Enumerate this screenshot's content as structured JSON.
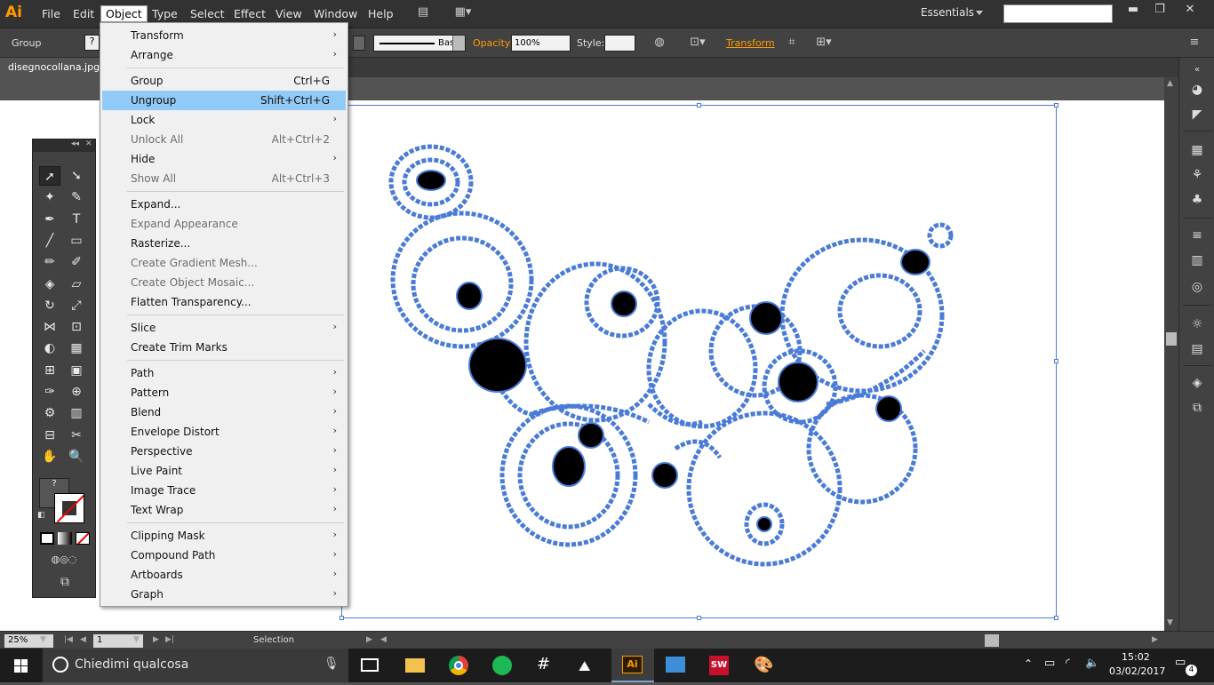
{
  "app": {
    "logo": "Ai",
    "accent_color": "#ff9a00"
  },
  "menubar": {
    "items": [
      "File",
      "Edit",
      "Object",
      "Type",
      "Select",
      "Effect",
      "View",
      "Window",
      "Help"
    ],
    "workspace": "Essentials",
    "search_value": ""
  },
  "controlbar": {
    "selection_type": "Group",
    "stroke_profile": "Basic",
    "opacity_label": "Opacity:",
    "opacity_value": "100%",
    "style_label": "Style:",
    "transform_label": "Transform"
  },
  "document": {
    "tab_title": "disegnocollana.jpg*"
  },
  "statusbar": {
    "zoom": "25%",
    "page": "1",
    "status": "Selection"
  },
  "object_menu": {
    "items": [
      {
        "label": "Transform",
        "shortcut": "",
        "submenu": true,
        "disabled": false
      },
      {
        "label": "Arrange",
        "shortcut": "",
        "submenu": true,
        "disabled": false
      },
      {
        "label": "Group",
        "shortcut": "Ctrl+G",
        "submenu": false,
        "disabled": false
      },
      {
        "label": "Ungroup",
        "shortcut": "Shift+Ctrl+G",
        "submenu": false,
        "disabled": false,
        "highlighted": true
      },
      {
        "label": "Lock",
        "shortcut": "",
        "submenu": true,
        "disabled": false
      },
      {
        "label": "Unlock All",
        "shortcut": "Alt+Ctrl+2",
        "submenu": false,
        "disabled": true
      },
      {
        "label": "Hide",
        "shortcut": "",
        "submenu": true,
        "disabled": false
      },
      {
        "label": "Show All",
        "shortcut": "Alt+Ctrl+3",
        "submenu": false,
        "disabled": true
      },
      {
        "label": "Expand...",
        "shortcut": "",
        "submenu": false,
        "disabled": false
      },
      {
        "label": "Expand Appearance",
        "shortcut": "",
        "submenu": false,
        "disabled": true
      },
      {
        "label": "Rasterize...",
        "shortcut": "",
        "submenu": false,
        "disabled": false
      },
      {
        "label": "Create Gradient Mesh...",
        "shortcut": "",
        "submenu": false,
        "disabled": true
      },
      {
        "label": "Create Object Mosaic...",
        "shortcut": "",
        "submenu": false,
        "disabled": true
      },
      {
        "label": "Flatten Transparency...",
        "shortcut": "",
        "submenu": false,
        "disabled": false
      },
      {
        "label": "Slice",
        "shortcut": "",
        "submenu": true,
        "disabled": false
      },
      {
        "label": "Create Trim Marks",
        "shortcut": "",
        "submenu": false,
        "disabled": false
      },
      {
        "label": "Path",
        "shortcut": "",
        "submenu": true,
        "disabled": false
      },
      {
        "label": "Pattern",
        "shortcut": "",
        "submenu": true,
        "disabled": false
      },
      {
        "label": "Blend",
        "shortcut": "",
        "submenu": true,
        "disabled": false
      },
      {
        "label": "Envelope Distort",
        "shortcut": "",
        "submenu": true,
        "disabled": false
      },
      {
        "label": "Perspective",
        "shortcut": "",
        "submenu": true,
        "disabled": false
      },
      {
        "label": "Live Paint",
        "shortcut": "",
        "submenu": true,
        "disabled": false
      },
      {
        "label": "Image Trace",
        "shortcut": "",
        "submenu": true,
        "disabled": false
      },
      {
        "label": "Text Wrap",
        "shortcut": "",
        "submenu": true,
        "disabled": false
      },
      {
        "label": "Clipping Mask",
        "shortcut": "",
        "submenu": true,
        "disabled": false
      },
      {
        "label": "Compound Path",
        "shortcut": "",
        "submenu": true,
        "disabled": false
      },
      {
        "label": "Artboards",
        "shortcut": "",
        "submenu": true,
        "disabled": false
      },
      {
        "label": "Graph",
        "shortcut": "",
        "submenu": true,
        "disabled": false
      }
    ]
  },
  "tools": [
    "selection-tool",
    "direct-selection-tool",
    "magic-wand-tool",
    "lasso-tool",
    "pen-tool",
    "type-tool",
    "line-tool",
    "rectangle-tool",
    "paintbrush-tool",
    "pencil-tool",
    "blob-brush-tool",
    "eraser-tool",
    "rotate-tool",
    "scale-tool",
    "width-tool",
    "free-transform-tool",
    "shape-builder-tool",
    "perspective-grid-tool",
    "mesh-tool",
    "gradient-tool",
    "eyedropper-tool",
    "blend-tool",
    "symbol-sprayer-tool",
    "column-graph-tool",
    "artboard-tool",
    "slice-tool",
    "hand-tool",
    "zoom-tool"
  ],
  "tools_icons": [
    "➚",
    "➘",
    "✦",
    "✎",
    "✒",
    "T",
    "╱",
    "▭",
    "✏",
    "✐",
    "◈",
    "▱",
    "↻",
    "⤢",
    "⋈",
    "⊡",
    "◐",
    "▦",
    "⊞",
    "▣",
    "✑",
    "⊕",
    "⚙",
    "▥",
    "⊟",
    "✂",
    "✋",
    "🔍"
  ],
  "fill_stroke": {
    "fill_label": "?"
  },
  "taskbar": {
    "search_placeholder": "Chiedimi qualcosa",
    "time": "15:02",
    "date": "03/02/2017",
    "notifications": "4"
  }
}
